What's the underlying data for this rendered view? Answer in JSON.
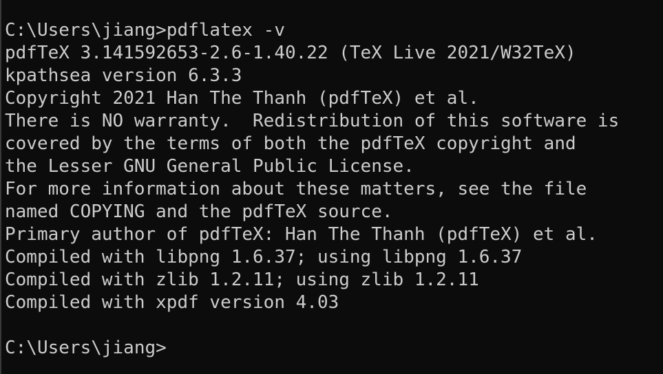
{
  "terminal": {
    "command_line": "C:\\Users\\jiang>pdflatex -v",
    "output": [
      "pdfTeX 3.141592653-2.6-1.40.22 (TeX Live 2021/W32TeX)",
      "kpathsea version 6.3.3",
      "Copyright 2021 Han The Thanh (pdfTeX) et al.",
      "There is NO warranty.  Redistribution of this software is",
      "covered by the terms of both the pdfTeX copyright and",
      "the Lesser GNU General Public License.",
      "For more information about these matters, see the file",
      "named COPYING and the pdfTeX source.",
      "Primary author of pdfTeX: Han The Thanh (pdfTeX) et al.",
      "Compiled with libpng 1.6.37; using libpng 1.6.37",
      "Compiled with zlib 1.2.11; using zlib 1.2.11",
      "Compiled with xpdf version 4.03"
    ],
    "prompt": "C:\\Users\\jiang>"
  }
}
